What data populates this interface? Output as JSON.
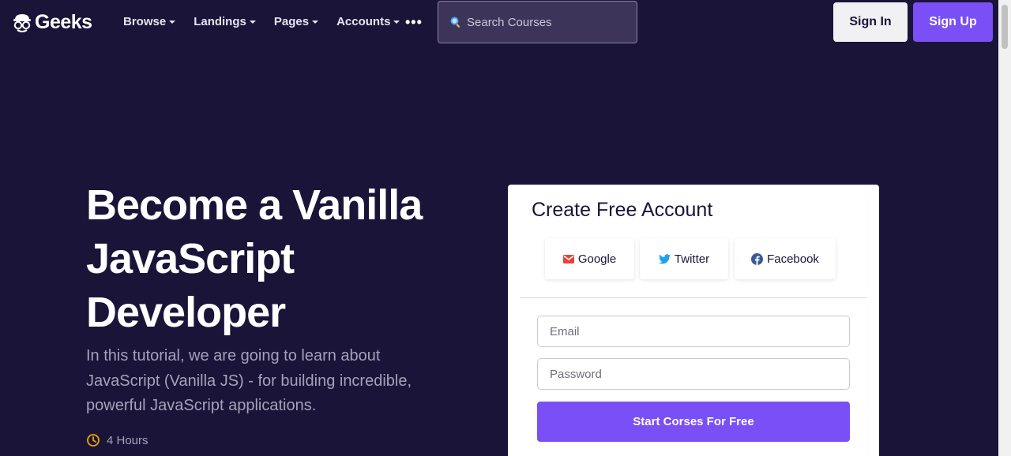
{
  "colors": {
    "background": "#1a1438",
    "accent": "#7a4ff5",
    "muted_text": "#a5a1bb",
    "clock_icon": "#f0a500"
  },
  "navbar": {
    "brand": {
      "name": "Geeks",
      "icon": "geek-mascot-icon"
    },
    "menu": [
      {
        "label": "Browse",
        "icon": "caret-down-icon"
      },
      {
        "label": "Landings",
        "icon": "caret-down-icon"
      },
      {
        "label": "Pages",
        "icon": "caret-down-icon"
      },
      {
        "label": "Accounts",
        "icon": "caret-down-icon"
      }
    ],
    "more_label": "•••",
    "search": {
      "placeholder": "Search Courses",
      "value": "",
      "icon": "search-icon"
    },
    "sign_in_label": "Sign In",
    "sign_up_label": "Sign Up"
  },
  "hero": {
    "title_lines": [
      "Become a Vanilla",
      "JavaScript",
      "Developer"
    ],
    "description": "In this tutorial, we are going to learn about JavaScript (Vanilla JS) - for building incredible, powerful JavaScript applications.",
    "duration": {
      "label": "4 Hours",
      "icon": "clock-icon"
    }
  },
  "signup_card": {
    "title": "Create Free Account",
    "social": [
      {
        "label": "Google",
        "icon": "gmail-icon",
        "color": "#ea4335"
      },
      {
        "label": "Twitter",
        "icon": "twitter-icon",
        "color": "#1da1f2"
      },
      {
        "label": "Facebook",
        "icon": "facebook-icon",
        "color": "#3b5998"
      }
    ],
    "email": {
      "placeholder": "Email",
      "value": ""
    },
    "password": {
      "placeholder": "Password",
      "value": ""
    },
    "submit_label": "Start Corses For Free"
  }
}
